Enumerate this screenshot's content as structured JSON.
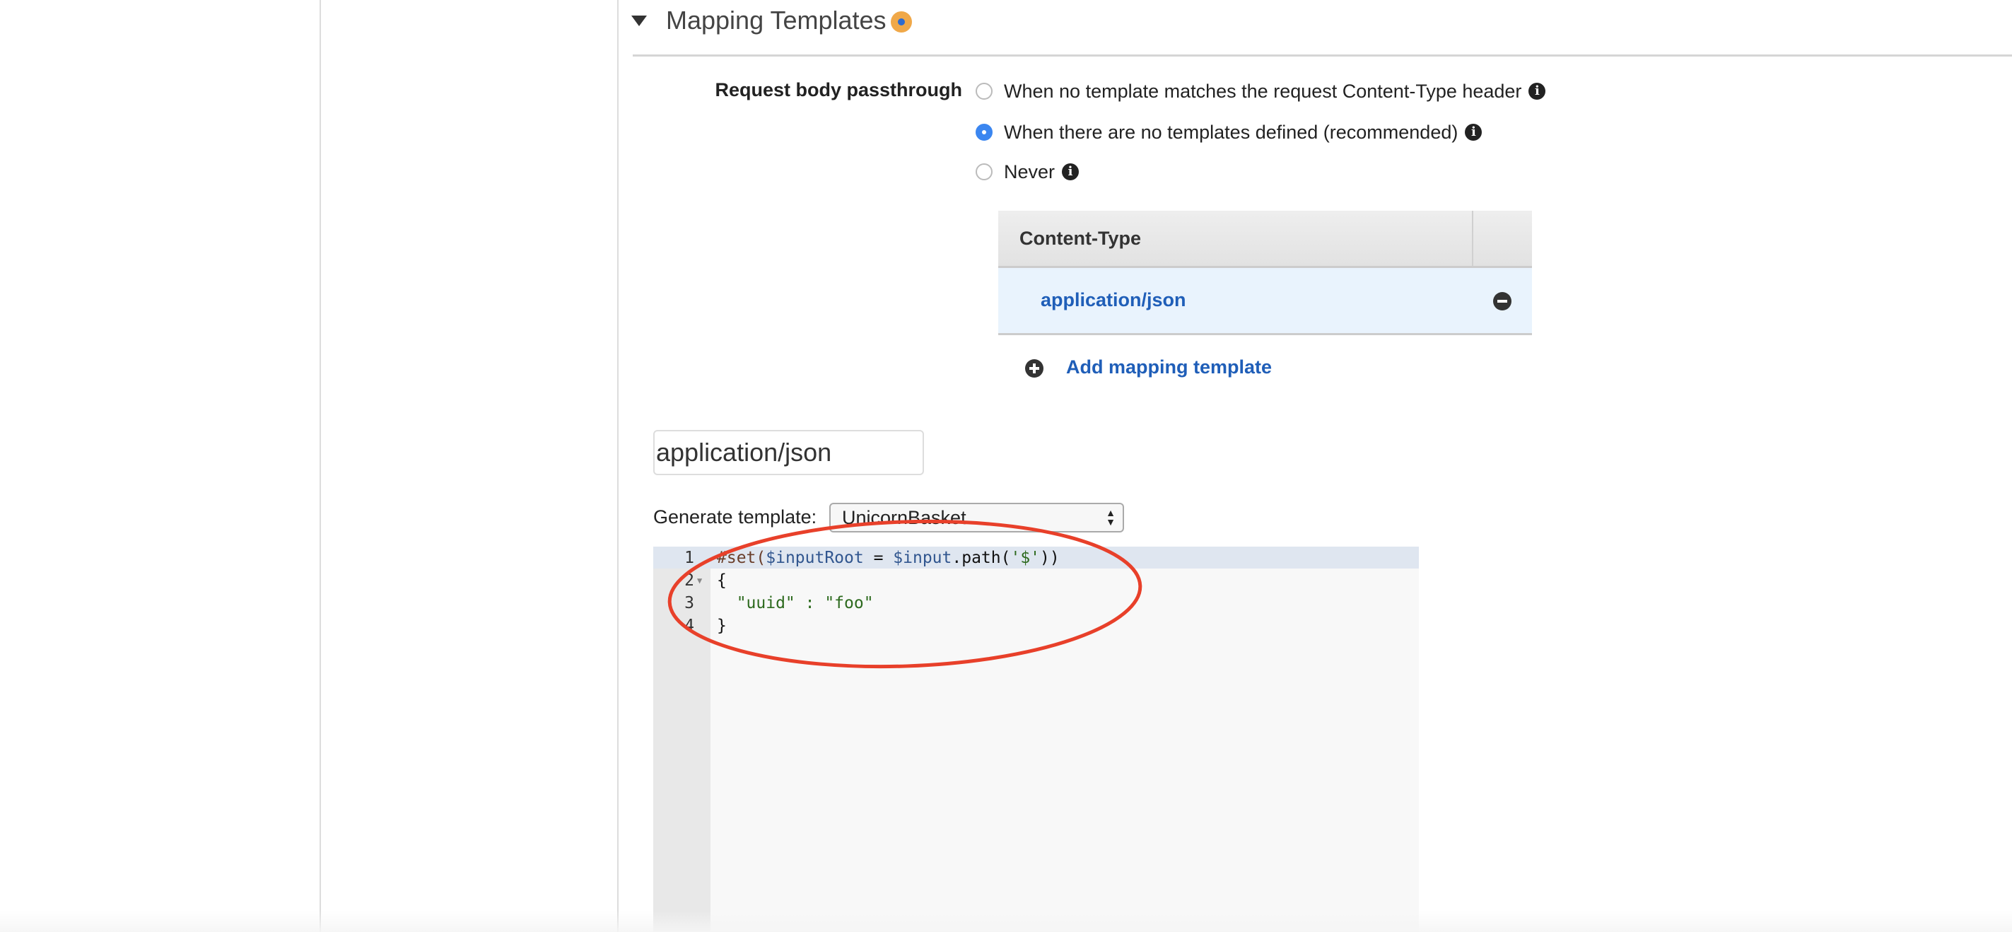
{
  "section": {
    "title": "Mapping Templates",
    "badge_icon": "info-badge-icon"
  },
  "passthrough": {
    "label": "Request body passthrough",
    "options": [
      {
        "label": "When no template matches the request Content-Type header",
        "selected": false
      },
      {
        "label": "When there are no templates defined (recommended)",
        "selected": true
      },
      {
        "label": "Never",
        "selected": false
      }
    ],
    "info_glyph": "i"
  },
  "table": {
    "header": "Content-Type",
    "rows": [
      "application/json"
    ]
  },
  "add_link": "Add mapping template",
  "content_type_input": {
    "value": "application/json"
  },
  "generate": {
    "label": "Generate template:",
    "selected": "UnicornBasket"
  },
  "editor": {
    "lines": [
      {
        "n": "1",
        "t": "#set($inputRoot = $input.path('$'))"
      },
      {
        "n": "2",
        "t": "{"
      },
      {
        "n": "3",
        "t": "  \"uuid\" : \"foo\""
      },
      {
        "n": "4",
        "t": "}"
      }
    ]
  },
  "annotation_color": "#e8402a"
}
